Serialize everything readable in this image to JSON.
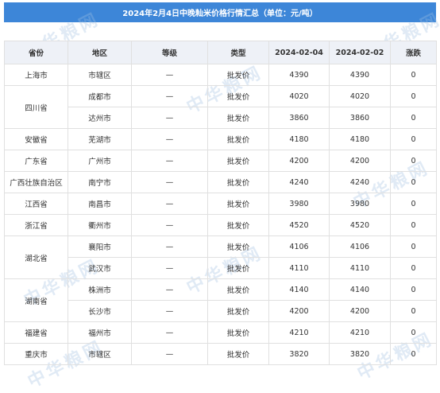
{
  "title": "2024年2月4日中晚籼米价格行情汇总（单位：元/吨）",
  "watermark_text": "中华粮网",
  "headers": [
    "省份",
    "地区",
    "等级",
    "类型",
    "2024-02-04",
    "2024-02-02",
    "涨跌"
  ],
  "rows": [
    {
      "province": "上海市",
      "span": 1,
      "region": "市辖区",
      "grade": "—",
      "type": "批发价",
      "v1": "4390",
      "v2": "4390",
      "change": "0"
    },
    {
      "province": "四川省",
      "span": 2,
      "region": "成都市",
      "grade": "—",
      "type": "批发价",
      "v1": "4020",
      "v2": "4020",
      "change": "0"
    },
    {
      "province": null,
      "span": 0,
      "region": "达州市",
      "grade": "—",
      "type": "批发价",
      "v1": "3860",
      "v2": "3860",
      "change": "0"
    },
    {
      "province": "安徽省",
      "span": 1,
      "region": "芜湖市",
      "grade": "—",
      "type": "批发价",
      "v1": "4180",
      "v2": "4180",
      "change": "0"
    },
    {
      "province": "广东省",
      "span": 1,
      "region": "广州市",
      "grade": "—",
      "type": "批发价",
      "v1": "4200",
      "v2": "4200",
      "change": "0"
    },
    {
      "province": "广西壮族自治区",
      "span": 1,
      "region": "南宁市",
      "grade": "—",
      "type": "批发价",
      "v1": "4240",
      "v2": "4240",
      "change": "0"
    },
    {
      "province": "江西省",
      "span": 1,
      "region": "南昌市",
      "grade": "—",
      "type": "批发价",
      "v1": "3980",
      "v2": "3980",
      "change": "0"
    },
    {
      "province": "浙江省",
      "span": 1,
      "region": "衢州市",
      "grade": "—",
      "type": "批发价",
      "v1": "4520",
      "v2": "4520",
      "change": "0"
    },
    {
      "province": "湖北省",
      "span": 2,
      "region": "襄阳市",
      "grade": "—",
      "type": "批发价",
      "v1": "4106",
      "v2": "4106",
      "change": "0"
    },
    {
      "province": null,
      "span": 0,
      "region": "武汉市",
      "grade": "—",
      "type": "批发价",
      "v1": "4110",
      "v2": "4110",
      "change": "0"
    },
    {
      "province": "湖南省",
      "span": 2,
      "region": "株洲市",
      "grade": "—",
      "type": "批发价",
      "v1": "4140",
      "v2": "4140",
      "change": "0"
    },
    {
      "province": null,
      "span": 0,
      "region": "长沙市",
      "grade": "—",
      "type": "批发价",
      "v1": "4200",
      "v2": "4200",
      "change": "0"
    },
    {
      "province": "福建省",
      "span": 1,
      "region": "福州市",
      "grade": "—",
      "type": "批发价",
      "v1": "4210",
      "v2": "4210",
      "change": "0"
    },
    {
      "province": "重庆市",
      "span": 1,
      "region": "市辖区",
      "grade": "—",
      "type": "批发价",
      "v1": "3820",
      "v2": "3820",
      "change": "0"
    }
  ]
}
